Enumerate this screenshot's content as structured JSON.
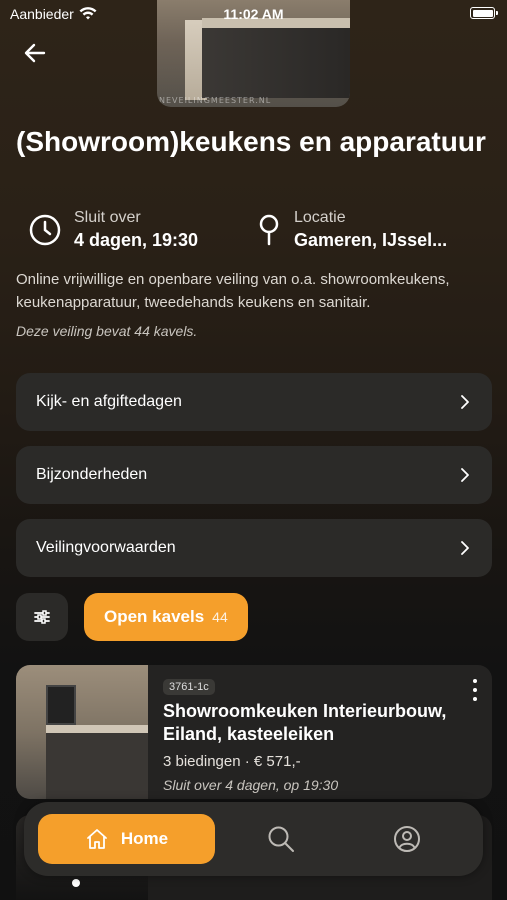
{
  "status_bar": {
    "carrier": "Aanbieder",
    "time": "11:02 AM"
  },
  "hero": {
    "watermark": "NEVEILINGMEESTER.NL"
  },
  "auction": {
    "title": "(Showroom)keukens en apparatuur",
    "closes_label": "Sluit over",
    "closes_value": "4 dagen, 19:30",
    "location_label": "Locatie",
    "location_value": "Gameren, IJssel...",
    "description": "Online vrijwillige en openbare veiling van o.a. showroomkeukens, keukenapparatuur, tweedehands keukens en sanitair.",
    "lot_count_text": "Deze veiling bevat 44 kavels."
  },
  "info_rows": [
    {
      "label": "Kijk- en afgiftedagen"
    },
    {
      "label": "Bijzonderheden"
    },
    {
      "label": "Veilingvoorwaarden"
    }
  ],
  "actions": {
    "open_lots_label": "Open kavels",
    "open_lots_count": "44"
  },
  "lots": [
    {
      "tag": "3761-1c",
      "title": "Showroomkeuken Interieurbouw, Eiland, kasteeleiken",
      "bids": "3 biedingen · € 571,-",
      "closes": "Sluit over 4 dagen, op 19:30"
    }
  ],
  "bottom_nav": {
    "home_label": "Home"
  },
  "icons": [
    "wifi-icon",
    "battery-icon",
    "back-arrow-icon",
    "clock-icon",
    "location-pin-icon",
    "chevron-right-icon",
    "filter-sliders-icon",
    "more-vertical-icon",
    "home-icon",
    "search-icon",
    "profile-icon"
  ],
  "colors": {
    "accent": "#f59f2b",
    "card": "#2b2a28",
    "background_top": "#2e2418",
    "background_bottom": "#111111"
  }
}
